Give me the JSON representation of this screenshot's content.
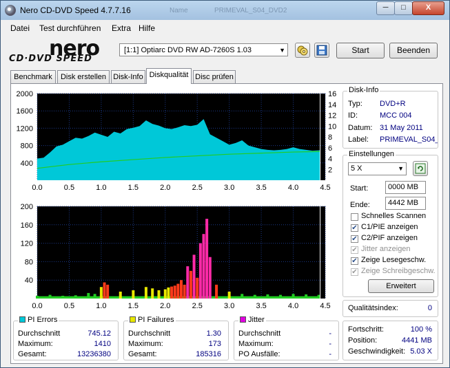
{
  "window": {
    "title": "Nero CD-DVD Speed 4.7.7.16",
    "ghost_title_1": "Name",
    "ghost_title_2": "PRIMEVAL_S04_DVD2"
  },
  "titlebar_buttons": {
    "minimize": "─",
    "maximize": "□",
    "close": "X"
  },
  "menu": [
    "Datei",
    "Test durchführen",
    "Extra",
    "Hilfe"
  ],
  "logo": {
    "line1": "nero",
    "line2": "CD·DVD SPEED"
  },
  "drive": {
    "selected": "[1:1]  Optiarc DVD RW AD-7260S 1.03"
  },
  "buttons": {
    "start": "Start",
    "exit": "Beenden"
  },
  "tabs": [
    "Benchmark",
    "Disk erstellen",
    "Disk-Info",
    "Diskqualität",
    "Disc prüfen"
  ],
  "active_tab": 3,
  "disk_info": {
    "title": "Disk-Info",
    "type_label": "Typ:",
    "type": "DVD+R",
    "id_label": "ID:",
    "id": "MCC 004",
    "date_label": "Datum:",
    "date": "31 May 2011",
    "label_label": "Label:",
    "label": "PRIMEVAL_S04_"
  },
  "settings": {
    "title": "Einstellungen",
    "speed": "5 X",
    "start_label": "Start:",
    "start": "0000 MB",
    "end_label": "Ende:",
    "end": "4442 MB",
    "quick_scan": "Schnelles Scannen",
    "c1": "C1/PIE anzeigen",
    "c2": "C2/PIF anzeigen",
    "jitter": "Jitter anzeigen",
    "read_speed": "Zeige Lesegeschw.",
    "write_speed": "Zeige Schreibgeschw.",
    "advanced": "Erweitert",
    "checked": {
      "quick_scan": false,
      "c1": true,
      "c2": true,
      "jitter": false,
      "read_speed": true,
      "write_speed": true
    }
  },
  "quality": {
    "label": "Qualitätsindex:",
    "value": "0"
  },
  "progress": {
    "progress_label": "Fortschritt:",
    "progress": "100 %",
    "position_label": "Position:",
    "position": "4441 MB",
    "speed_label": "Geschwindigkeit:",
    "speed": "5.03 X"
  },
  "stats": {
    "pi_errors": {
      "title": "PI Errors",
      "color": "#00c8d8",
      "avg_label": "Durchschnitt",
      "avg": "745.12",
      "max_label": "Maximum:",
      "max": "1410",
      "total_label": "Gesamt:",
      "total": "13236380"
    },
    "pi_failures": {
      "title": "PI Failures",
      "color": "#e8e800",
      "avg_label": "Durchschnitt",
      "avg": "1.30",
      "max_label": "Maximum:",
      "max": "173",
      "total_label": "Gesamt:",
      "total": "185316"
    },
    "jitter": {
      "title": "Jitter",
      "color": "#e000e0",
      "avg_label": "Durchschnitt",
      "avg": "-",
      "max_label": "Maximum:",
      "max": "-",
      "po_label": "PO Ausfälle:",
      "po": "-"
    }
  },
  "chart_data": [
    {
      "type": "area",
      "x_ticks": [
        "0.0",
        "0.5",
        "1.0",
        "1.5",
        "2.0",
        "2.5",
        "3.0",
        "3.5",
        "4.0",
        "4.5"
      ],
      "y_ticks_left": [
        "400",
        "800",
        "1200",
        "1600",
        "2000"
      ],
      "y_ticks_right": [
        "2",
        "4",
        "6",
        "8",
        "10",
        "12",
        "14",
        "16"
      ],
      "xlim": [
        0,
        4.5
      ],
      "ylim_left": [
        0,
        2000
      ],
      "ylim_right": [
        0,
        16
      ],
      "series": [
        {
          "x": [
            0.0,
            0.1,
            0.2,
            0.3,
            0.4,
            0.5,
            0.6,
            0.7,
            0.8,
            0.9,
            1.0,
            1.1,
            1.2,
            1.3,
            1.4,
            1.5,
            1.6,
            1.7,
            1.8,
            1.9,
            2.0,
            2.1,
            2.2,
            2.3,
            2.4,
            2.5,
            2.6,
            2.7,
            2.8,
            2.9,
            3.0,
            3.1,
            3.2,
            3.3,
            3.4,
            3.5,
            3.6,
            3.7,
            3.8,
            3.9,
            4.0,
            4.1,
            4.2,
            4.3,
            4.42
          ],
          "values": [
            500,
            520,
            640,
            780,
            820,
            900,
            980,
            960,
            1020,
            1100,
            1050,
            1000,
            1120,
            1080,
            1180,
            1210,
            1250,
            1380,
            1300,
            1260,
            1200,
            1180,
            1220,
            1270,
            1250,
            1280,
            1410,
            1060,
            980,
            900,
            820,
            860,
            920,
            800,
            760,
            720,
            700,
            690,
            700,
            720,
            760,
            720,
            700,
            680,
            690
          ]
        },
        {
          "x": [
            0.0,
            0.5,
            1.0,
            1.5,
            2.0,
            2.5,
            3.0,
            3.5,
            4.0,
            4.42
          ],
          "values": [
            2.2,
            2.9,
            3.4,
            3.8,
            4.2,
            4.5,
            4.8,
            5.0,
            5.2,
            5.3
          ]
        }
      ]
    },
    {
      "type": "bar",
      "x_ticks": [
        "0.0",
        "0.5",
        "1.0",
        "1.5",
        "2.0",
        "2.5",
        "3.0",
        "3.5",
        "4.0",
        "4.5"
      ],
      "y_ticks": [
        "40",
        "80",
        "120",
        "160",
        "200"
      ],
      "xlim": [
        0,
        4.5
      ],
      "ylim": [
        0,
        200
      ],
      "series": [
        {
          "x": [
            0.0,
            0.2,
            0.4,
            0.6,
            0.8,
            0.9,
            1.0,
            1.05,
            1.1,
            1.3,
            1.5,
            1.7,
            1.8,
            1.9,
            2.0,
            2.05,
            2.1,
            2.15,
            2.2,
            2.25,
            2.3,
            2.35,
            2.4,
            2.45,
            2.5,
            2.55,
            2.6,
            2.65,
            2.7,
            2.8,
            3.0,
            3.2,
            3.4,
            3.6,
            3.8,
            4.0,
            4.2,
            4.4
          ],
          "values": [
            6,
            8,
            6,
            7,
            12,
            10,
            25,
            35,
            30,
            15,
            18,
            25,
            22,
            18,
            20,
            24,
            26,
            28,
            32,
            40,
            30,
            70,
            60,
            95,
            45,
            120,
            140,
            173,
            90,
            30,
            15,
            10,
            8,
            9,
            8,
            10,
            9,
            8
          ]
        }
      ]
    }
  ]
}
